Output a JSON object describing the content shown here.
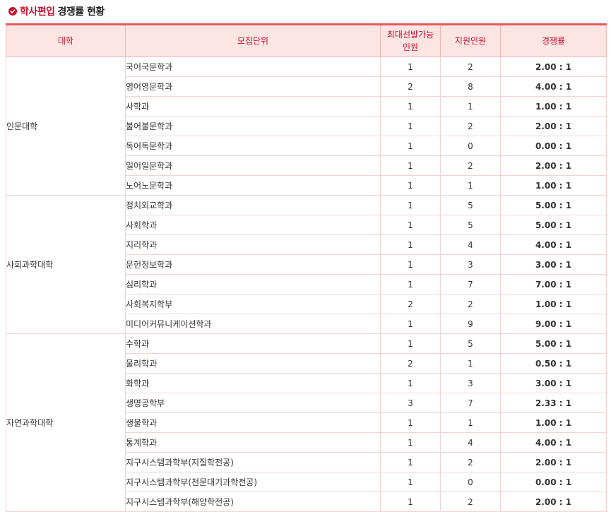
{
  "page": {
    "title_accent": "학사편입",
    "title_rest": "경쟁률 현황",
    "check_icon": "check-circle-icon"
  },
  "colors": {
    "accent": "#c8102e",
    "header_bg": "#fde5e4",
    "ratio_black": "#222222",
    "ratio_blue": "#3a57c4",
    "ratio_red": "#e01e1e"
  },
  "table": {
    "headers": [
      "대학",
      "모집단위",
      "최대선발가능\n인원",
      "지원인원",
      "경쟁률"
    ],
    "groups": [
      {
        "college": "인문대학",
        "rows": [
          {
            "dept": "국어국문학과",
            "quota": "1",
            "applicants": "2",
            "ratio": "2.00 : 1",
            "color": "black"
          },
          {
            "dept": "영어영문학과",
            "quota": "2",
            "applicants": "8",
            "ratio": "4.00 : 1",
            "color": "blue"
          },
          {
            "dept": "사학과",
            "quota": "1",
            "applicants": "1",
            "ratio": "1.00 : 1",
            "color": "black"
          },
          {
            "dept": "불어불문학과",
            "quota": "1",
            "applicants": "2",
            "ratio": "2.00 : 1",
            "color": "black"
          },
          {
            "dept": "독어독문학과",
            "quota": "1",
            "applicants": "0",
            "ratio": "0.00 : 1",
            "color": "black"
          },
          {
            "dept": "일어일문학과",
            "quota": "1",
            "applicants": "2",
            "ratio": "2.00 : 1",
            "color": "black"
          },
          {
            "dept": "노어노문학과",
            "quota": "1",
            "applicants": "1",
            "ratio": "1.00 : 1",
            "color": "black"
          }
        ]
      },
      {
        "college": "사회과학대학",
        "rows": [
          {
            "dept": "정치외교학과",
            "quota": "1",
            "applicants": "5",
            "ratio": "5.00 : 1",
            "color": "blue"
          },
          {
            "dept": "사회학과",
            "quota": "1",
            "applicants": "5",
            "ratio": "5.00 : 1",
            "color": "blue"
          },
          {
            "dept": "지리학과",
            "quota": "1",
            "applicants": "4",
            "ratio": "4.00 : 1",
            "color": "blue"
          },
          {
            "dept": "문헌정보학과",
            "quota": "1",
            "applicants": "3",
            "ratio": "3.00 : 1",
            "color": "black"
          },
          {
            "dept": "심리학과",
            "quota": "1",
            "applicants": "7",
            "ratio": "7.00 : 1",
            "color": "red"
          },
          {
            "dept": "사회복지학부",
            "quota": "2",
            "applicants": "2",
            "ratio": "1.00 : 1",
            "color": "black"
          },
          {
            "dept": "미디어커뮤니케이션학과",
            "quota": "1",
            "applicants": "9",
            "ratio": "9.00 : 1",
            "color": "red"
          }
        ]
      },
      {
        "college": "자연과학대학",
        "rows": [
          {
            "dept": "수학과",
            "quota": "1",
            "applicants": "5",
            "ratio": "5.00 : 1",
            "color": "blue"
          },
          {
            "dept": "물리학과",
            "quota": "2",
            "applicants": "1",
            "ratio": "0.50 : 1",
            "color": "black"
          },
          {
            "dept": "화학과",
            "quota": "1",
            "applicants": "3",
            "ratio": "3.00 : 1",
            "color": "black"
          },
          {
            "dept": "생명공학부",
            "quota": "3",
            "applicants": "7",
            "ratio": "2.33 : 1",
            "color": "black"
          },
          {
            "dept": "생물학과",
            "quota": "1",
            "applicants": "1",
            "ratio": "1.00 : 1",
            "color": "black"
          },
          {
            "dept": "통계학과",
            "quota": "1",
            "applicants": "4",
            "ratio": "4.00 : 1",
            "color": "blue"
          },
          {
            "dept": "지구시스템과학부(지질학전공)",
            "quota": "1",
            "applicants": "2",
            "ratio": "2.00 : 1",
            "color": "black"
          },
          {
            "dept": "지구시스템과학부(천문대기과학전공)",
            "quota": "1",
            "applicants": "0",
            "ratio": "0.00 : 1",
            "color": "black"
          },
          {
            "dept": "지구시스템과학부(해양학전공)",
            "quota": "1",
            "applicants": "2",
            "ratio": "2.00 : 1",
            "color": "black"
          }
        ]
      }
    ]
  }
}
